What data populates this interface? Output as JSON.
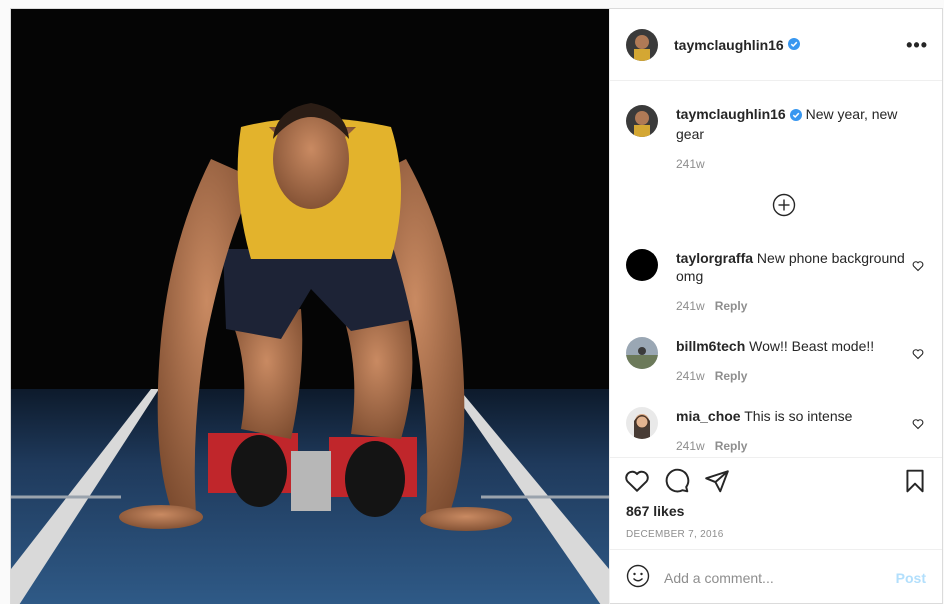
{
  "post": {
    "username": "taymclaughlin16",
    "verified": true,
    "more_icon": "more-dots-icon"
  },
  "caption": {
    "username": "taymclaughlin16",
    "text": "New year, new gear",
    "time": "241w"
  },
  "load_more_icon": "plus-circle-icon",
  "comments": [
    {
      "username": "taylorgraffa",
      "text": "New phone background omg",
      "time": "241w",
      "reply": "Reply"
    },
    {
      "username": "billm6tech",
      "text": "Wow!! Beast mode!!",
      "time": "241w",
      "reply": "Reply"
    },
    {
      "username": "mia_choe",
      "text": "This is so intense",
      "time": "241w",
      "reply": "Reply"
    }
  ],
  "actions": {
    "likes": "867 likes",
    "date": "DECEMBER 7, 2016",
    "icons": [
      "heart-icon",
      "comment-icon",
      "share-icon",
      "bookmark-icon"
    ]
  },
  "add_comment": {
    "placeholder": "Add a comment...",
    "post_label": "Post"
  },
  "colors": {
    "verified": "#3897f0",
    "post_button_disabled": "#b2dffc",
    "muted_text": "#8e8e8e"
  }
}
